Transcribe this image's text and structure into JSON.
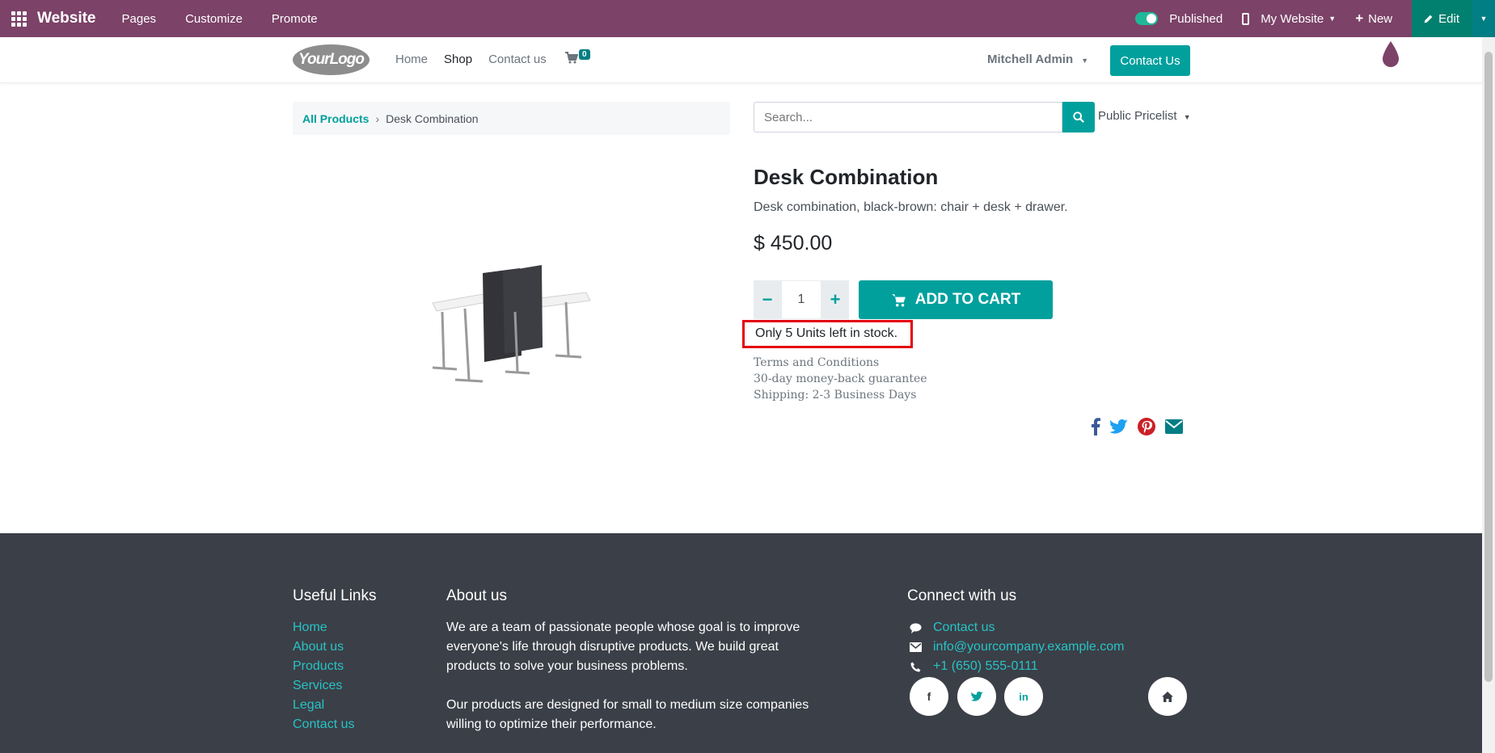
{
  "topbar": {
    "brand": "Website",
    "menu": [
      "Pages",
      "Customize",
      "Promote"
    ],
    "published_label": "Published",
    "site_label": "My Website",
    "new_label": "New",
    "edit_label": "Edit"
  },
  "header": {
    "logo_text": "YourLogo",
    "nav": [
      "Home",
      "Shop",
      "Contact us"
    ],
    "cart_count": "0",
    "user": "Mitchell Admin",
    "contact_button": "Contact Us"
  },
  "breadcrumb": {
    "parent": "All Products",
    "current": "Desk Combination"
  },
  "search": {
    "placeholder": "Search..."
  },
  "pricelist": "Public Pricelist",
  "product": {
    "title": "Desk Combination",
    "description": "Desk combination, black-brown: chair + desk + drawer.",
    "price": "$ 450.00",
    "quantity": "1",
    "add_to_cart": "ADD TO CART",
    "stock_message": "Only 5 Units left in stock.",
    "terms": [
      "Terms and Conditions",
      "30-day money-back guarantee",
      "Shipping: 2-3 Business Days"
    ]
  },
  "footer": {
    "useful_links_title": "Useful Links",
    "useful_links": [
      "Home",
      "About us",
      "Products",
      "Services",
      "Legal",
      "Contact us"
    ],
    "about_title": "About us",
    "about_paragraphs": [
      "We are a team of passionate people whose goal is to improve everyone's life through disruptive products. We build great products to solve your business problems.",
      "Our products are designed for small to medium size companies willing to optimize their performance."
    ],
    "connect_title": "Connect with us",
    "contact_link": "Contact us",
    "email": "info@yourcompany.example.com",
    "phone": "+1 (650) 555-0111"
  },
  "colors": {
    "admin_bar": "#7c4268",
    "accent": "#01a09d",
    "footer_bg": "#3b3f47",
    "stock_highlight": "#e3000f"
  }
}
